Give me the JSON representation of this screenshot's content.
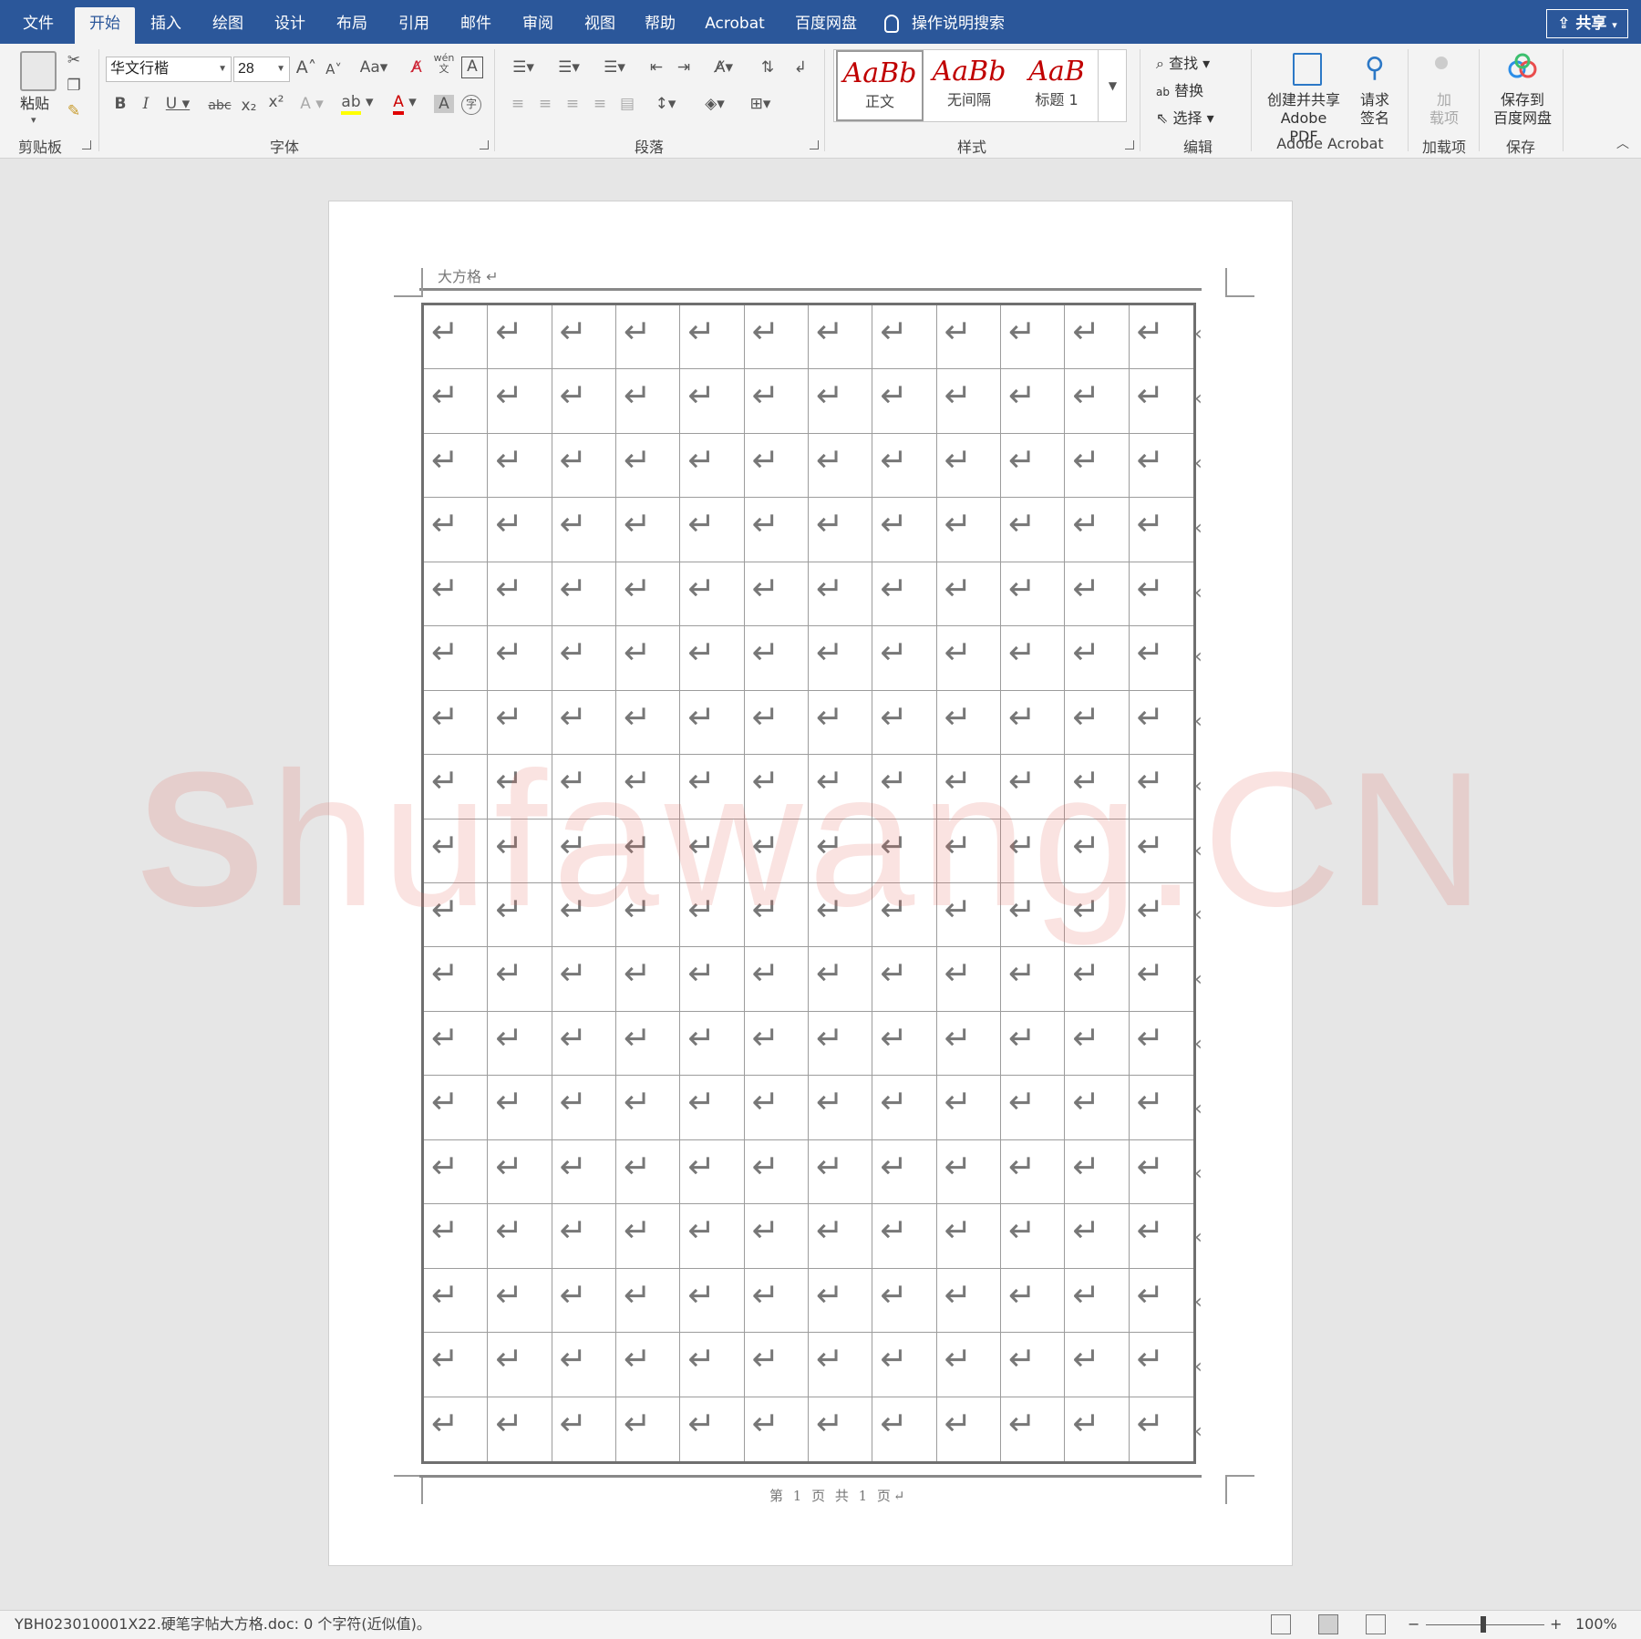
{
  "tabs": [
    "文件",
    "开始",
    "插入",
    "绘图",
    "设计",
    "布局",
    "引用",
    "邮件",
    "审阅",
    "视图",
    "帮助",
    "Acrobat",
    "百度网盘"
  ],
  "tell_me": "操作说明搜索",
  "share": "共享",
  "ribbon": {
    "clipboard": {
      "paste": "粘贴",
      "label": "剪贴板"
    },
    "font": {
      "name": "华文行楷",
      "size": "28",
      "case_btn": "Aa",
      "phonetic": "wén",
      "label": "字体"
    },
    "paragraph": {
      "label": "段落"
    },
    "styles": {
      "items": [
        {
          "sample": "AaBb",
          "name": "正文"
        },
        {
          "sample": "AaBb",
          "name": "无间隔"
        },
        {
          "sample": "AaB",
          "name": "标题 1"
        }
      ],
      "label": "样式"
    },
    "editing": {
      "find": "查找",
      "replace": "替换",
      "select": "选择",
      "label": "编辑"
    },
    "acrobat": {
      "create_share": "创建并共享",
      "create_share_2": "Adobe PDF",
      "request_sign": "请求",
      "request_sign_2": "签名",
      "label": "Adobe Acrobat"
    },
    "addins": {
      "btn": "加",
      "btn2": "载项",
      "label": "加载项"
    },
    "save": {
      "btn": "保存到",
      "btn2": "百度网盘",
      "label": "保存"
    }
  },
  "document": {
    "header": "大方格 ↵",
    "footer": "第 1 页 共 1 页↵",
    "watermark_a": "S",
    "watermark_b": "hufawang.CN"
  },
  "grid": {
    "rows": 18,
    "cols": 12
  },
  "status": {
    "text": "YBH023010001X22.硬笔字帖大方格.doc: 0 个字符(近似值)。",
    "zoom": "100%"
  },
  "colors": {
    "accent": "#2b579a",
    "ribbon": "#f3f3f3",
    "style_sample": "#c00000",
    "watermark": "#e1645a"
  }
}
